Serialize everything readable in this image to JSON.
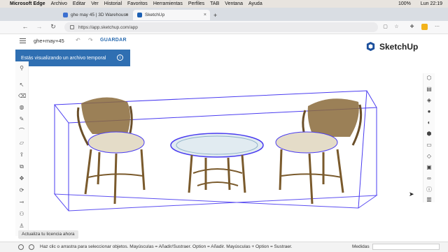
{
  "menubar": {
    "apple": "",
    "app": "Microsoft Edge",
    "items": [
      "Archivo",
      "Editar",
      "Ver",
      "Historial",
      "Favoritos",
      "Herramientas",
      "Perfiles",
      "TAB",
      "Ventana",
      "Ayuda"
    ],
    "battery": "100%",
    "clock": "Lun 22:19"
  },
  "tabs": [
    {
      "label": "ghe may 45 | 3D Warehouse",
      "active": false,
      "icon": "3d-warehouse-icon"
    },
    {
      "label": "SketchUp",
      "active": true,
      "icon": "sketchup-icon"
    }
  ],
  "address": {
    "url": "https://app.sketchup.com/app"
  },
  "app": {
    "doc_name": "ghe+may+45",
    "save_label": "GUARDAR",
    "banner_text": "Estás visualizando un archivo temporal",
    "brand": "SketchUp",
    "license_button": "Actualiza tu licencia ahora"
  },
  "status": {
    "hint": "Haz clic o arrastra para seleccionar objetos. Mayúsculas = Añadir/Sustraer. Option = Añadir. Mayúsculas + Option = Sustraer.",
    "measures_label": "Medidas"
  },
  "colors": {
    "accent": "#2f6fb2",
    "selection": "#4a3cf0"
  }
}
